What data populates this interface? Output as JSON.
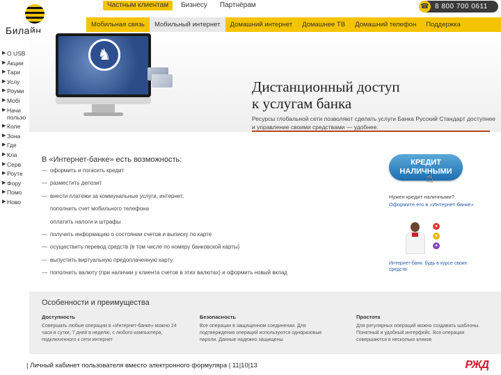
{
  "top": {
    "segments": [
      {
        "label": "Частным клиентам"
      },
      {
        "label": "Бизнесу"
      },
      {
        "label": "Партнёрам"
      }
    ],
    "phone": "8 800 700 0611"
  },
  "logo": {
    "text": "Билайн"
  },
  "nav": [
    {
      "label": "Мобильная связь"
    },
    {
      "label": "Мобильный интернет"
    },
    {
      "label": "Домашний интернет"
    },
    {
      "label": "Домашнее ТВ"
    },
    {
      "label": "Домашний телефон"
    },
    {
      "label": "Поддержка"
    }
  ],
  "sidebar": [
    {
      "label": "О USB"
    },
    {
      "label": "Акции"
    },
    {
      "label": "Тари"
    },
    {
      "label": "Услу"
    },
    {
      "label": "Роуми"
    },
    {
      "label": "Мобі"
    },
    {
      "label": "Начи пользо"
    },
    {
      "label": "Коле"
    },
    {
      "label": "Зона"
    },
    {
      "label": "Где"
    },
    {
      "label": "Кла"
    },
    {
      "label": "Серв"
    },
    {
      "label": "Роуте"
    },
    {
      "label": "Фору"
    },
    {
      "label": "Помо"
    },
    {
      "label": "Ново"
    }
  ],
  "banner": {
    "title_line1": "Дистанционный доступ",
    "title_line2": "к услугам банка",
    "description": "Ресурсы глобальной сети позволяют сделать услуги Банка Русский Стандарт доступнее и управление своими средствами — удобнее."
  },
  "features": {
    "title": "В «Интернет-банке» есть возможность:",
    "items": [
      {
        "text": "оформить и погасить кредит",
        "sub": false
      },
      {
        "text": "разместить депозит",
        "sub": false
      },
      {
        "text": "внести платежи за коммунальные услуги, интернет,",
        "sub": false
      },
      {
        "text": "пополнить счет мобильного телефона",
        "sub": true
      },
      {
        "text": "оплатить налоги и штрафы",
        "sub": true
      },
      {
        "text": "получить информацию о состоянии счетов и выписку по карте",
        "sub": false
      },
      {
        "text": "осуществить перевод средств (в том числе по номеру банковской карты)",
        "sub": false
      },
      {
        "text": "выпустить виртуальную предоплаченную карту",
        "sub": false
      },
      {
        "text": "пополнить валюту (при наличии у клиента счетов в этих валютах) и оформить новый вклад",
        "sub": false
      }
    ]
  },
  "promo": {
    "button_line1": "КРЕДИТ",
    "button_line2": "НАЛИЧНЫМИ",
    "question": "Нужен кредит наличными?",
    "link": "Оформите его в «Интернет-банке»",
    "consultant_text": "Интернет-банк: будь в курсе своих средств"
  },
  "advantages": {
    "title": "Особенности и преимущества",
    "columns": [
      {
        "heading": "Доступность",
        "text": "Совершать любые операции в «Интернет-банке» можно 24 часа в сутки, 7 дней в неделю, с любого компьютера, подключенного к сети интернет"
      },
      {
        "heading": "Безопасность",
        "text": "Все операции в защищенном соединении. Для подтверждения операций используются одноразовые пароли. Данные надежно защищены"
      },
      {
        "heading": "Простота",
        "text": "Для регулярных операций можно создавать шаблоны. Понятный и удобный интерфейс. Все операции совершаются в несколько кликов"
      }
    ]
  },
  "footer": {
    "text": "| Личный кабинет пользователя вместо электронного формуляра | 11|10|13",
    "logo": "РЖД"
  },
  "colors": {
    "brand_yellow": "#f5c400",
    "link_blue": "#2a5fa8",
    "accent_line": "#b8471e",
    "rzd_red": "#d0192a"
  }
}
